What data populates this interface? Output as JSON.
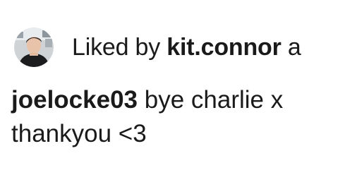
{
  "likes": {
    "prefix": "Liked by",
    "username": "kit.connor",
    "suffix": "a",
    "avatar_icon": "profile-photo-avatar"
  },
  "caption": {
    "author": "joelocke03",
    "line1": "bye charlie x",
    "line2": "thankyou <3"
  },
  "colors": {
    "text": "#1a1a1a",
    "background": "#ffffff"
  }
}
